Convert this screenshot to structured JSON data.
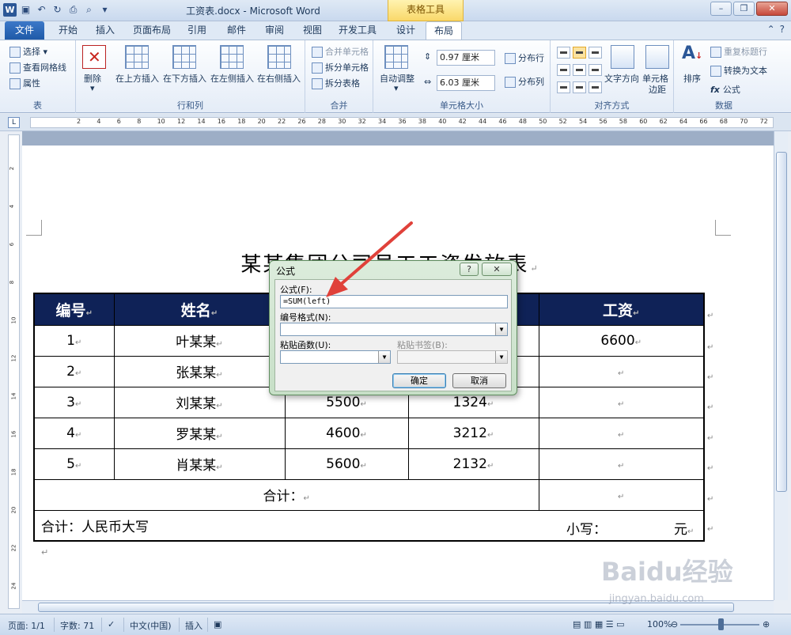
{
  "window": {
    "title": "工资表.docx - Microsoft Word",
    "context_tab": "表格工具",
    "qat_app_icon": "W"
  },
  "tabs": [
    "文件",
    "开始",
    "插入",
    "页面布局",
    "引用",
    "邮件",
    "审阅",
    "视图",
    "开发工具",
    "设计",
    "布局"
  ],
  "ribbon": {
    "group_table": {
      "label": "表",
      "select": "选择",
      "gridlines": "查看网格线",
      "properties": "属性"
    },
    "group_rows_cols": {
      "label": "行和列",
      "delete": "删除",
      "insert_above": "在上方插入",
      "insert_below": "在下方插入",
      "insert_left": "在左侧插入",
      "insert_right": "在右侧插入"
    },
    "group_merge": {
      "label": "合并",
      "merge_cells": "合并单元格",
      "split_cells": "拆分单元格",
      "split_table": "拆分表格"
    },
    "group_cell_size": {
      "label": "单元格大小",
      "autofit": "自动调整",
      "height": "0.97 厘米",
      "width": "6.03 厘米",
      "distribute_rows": "分布行",
      "distribute_cols": "分布列"
    },
    "group_alignment": {
      "label": "对齐方式",
      "text_direction": "文字方向",
      "cell_margins_1": "单元格",
      "cell_margins_2": "边距"
    },
    "group_data": {
      "label": "数据",
      "sort": "排序",
      "repeat_header": "重复标题行",
      "convert_text": "转换为文本",
      "formula": "公式"
    }
  },
  "ruler": {
    "ticks": [
      "2",
      "4",
      "6",
      "8",
      "10",
      "12",
      "14",
      "16",
      "18",
      "20",
      "22",
      "26",
      "28",
      "30",
      "32",
      "34",
      "36",
      "38",
      "40",
      "42",
      "44",
      "46",
      "48",
      "50",
      "52",
      "54",
      "56",
      "58",
      "60",
      "62",
      "64",
      "66",
      "68",
      "70",
      "72"
    ],
    "vticks": [
      "2",
      "4",
      "6",
      "8",
      "10",
      "12",
      "14",
      "16",
      "18",
      "20",
      "22",
      "24"
    ]
  },
  "document": {
    "title": "某某集团公司员工工资发放表",
    "headers": [
      "编号",
      "姓名",
      "",
      "",
      "工资"
    ],
    "rows": [
      {
        "id": "1",
        "name": "叶某某",
        "a": "",
        "b": "",
        "salary": "6600"
      },
      {
        "id": "2",
        "name": "张某某",
        "a": "",
        "b": "",
        "salary": ""
      },
      {
        "id": "3",
        "name": "刘某某",
        "a": "5500",
        "b": "1324",
        "salary": ""
      },
      {
        "id": "4",
        "name": "罗某某",
        "a": "4600",
        "b": "3212",
        "salary": ""
      },
      {
        "id": "5",
        "name": "肖某某",
        "a": "5600",
        "b": "2132",
        "salary": ""
      }
    ],
    "total_label": "合计：",
    "rmb_label": "合计：人民币大写",
    "small_label": "小写：",
    "yuan": "元"
  },
  "dialog": {
    "title": "公式",
    "help_btn": "?",
    "formula_label": "公式(F):",
    "formula_value": "=SUM(left)",
    "number_format_label": "编号格式(N):",
    "number_format_value": "",
    "paste_function_label": "粘贴函数(U):",
    "paste_bookmark_label": "粘贴书签(B):",
    "ok": "确定",
    "cancel": "取消"
  },
  "statusbar": {
    "page": "页面: 1/1",
    "words": "字数: 71",
    "language": "中文(中国)",
    "mode": "插入",
    "zoom": "100%"
  },
  "watermark": {
    "brand": "Baidu经验",
    "url": "jingyan.baidu.com"
  },
  "colors": {
    "header_bg": "#0f2257",
    "accent": "#2b5797",
    "arrow": "#e0413a"
  }
}
